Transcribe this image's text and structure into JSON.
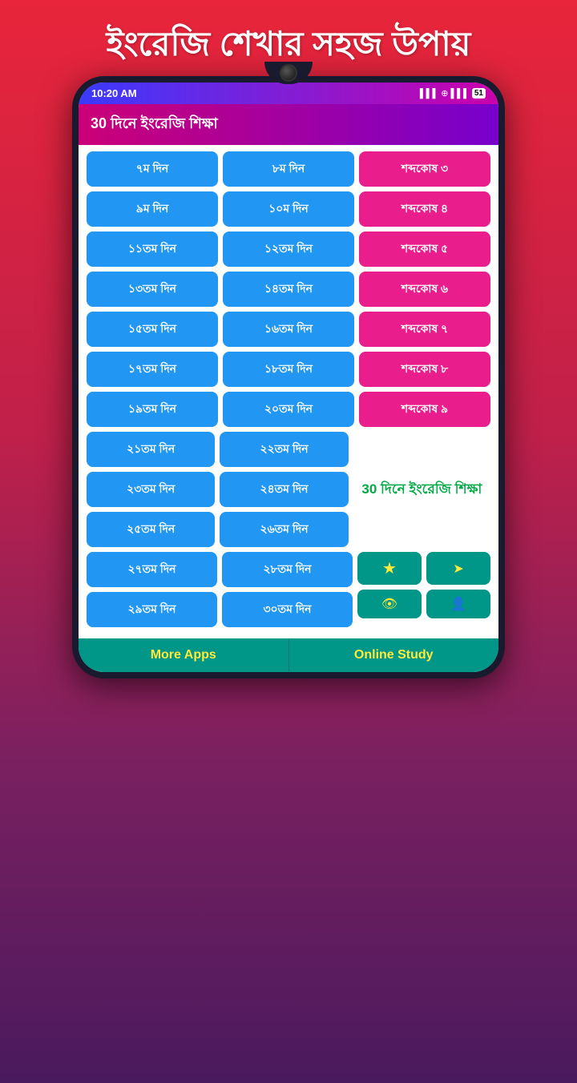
{
  "headline": "ইংরেজি শেখার সহজ উপায়",
  "status": {
    "time": "10:20 AM",
    "battery": "51"
  },
  "app_header_title": "30 দিনে ইংরেজি শিক্ষা",
  "rows": [
    {
      "col1": "৭ম দিন",
      "col2": "৮ম দিন",
      "col3": "শব্দকোষ ৩",
      "col3_type": "pink"
    },
    {
      "col1": "৯ম দিন",
      "col2": "১০ম দিন",
      "col3": "শব্দকোষ ৪",
      "col3_type": "pink"
    },
    {
      "col1": "১১তম দিন",
      "col2": "১২তম দিন",
      "col3": "শব্দকোষ ৫",
      "col3_type": "pink"
    },
    {
      "col1": "১৩তম দিন",
      "col2": "১৪তম দিন",
      "col3": "শব্দকোষ ৬",
      "col3_type": "pink"
    },
    {
      "col1": "১৫তম দিন",
      "col2": "১৬তম দিন",
      "col3": "শব্দকোষ ৭",
      "col3_type": "pink"
    },
    {
      "col1": "১৭তম দিন",
      "col2": "১৮তম দিন",
      "col3": "শব্দকোষ ৮",
      "col3_type": "pink"
    },
    {
      "col1": "১৯তম দিন",
      "col2": "২০তম দিন",
      "col3": "শব্দকোষ ৯",
      "col3_type": "pink"
    },
    {
      "col1": "২১তম দিন",
      "col2": "২২তম দিন",
      "col3_text": "30 দিনে ইংরেজি শিক্ষা",
      "col3_type": "text"
    },
    {
      "col1": "২৩তম দিন",
      "col2": "২৪তম দিন",
      "col3_type": "text_continue"
    },
    {
      "col1": "২৫তম দিন",
      "col2": "২৬তম দিন",
      "col3_type": "text_continue2"
    },
    {
      "col1": "২৭তম দিন",
      "col2": "২৮তম দিন",
      "col3_type": "icon_row1"
    },
    {
      "col1": "২৯তম দিন",
      "col2": "৩০তম দিন",
      "col3_type": "icon_row2"
    }
  ],
  "bottom_bar": {
    "left": "More Apps",
    "right": "Online Study"
  },
  "side_text": "30 দিনে ইংরেজি শিক্ষা",
  "icons": {
    "star": "★",
    "share": "◄",
    "eye": "👁",
    "person": "👤"
  }
}
